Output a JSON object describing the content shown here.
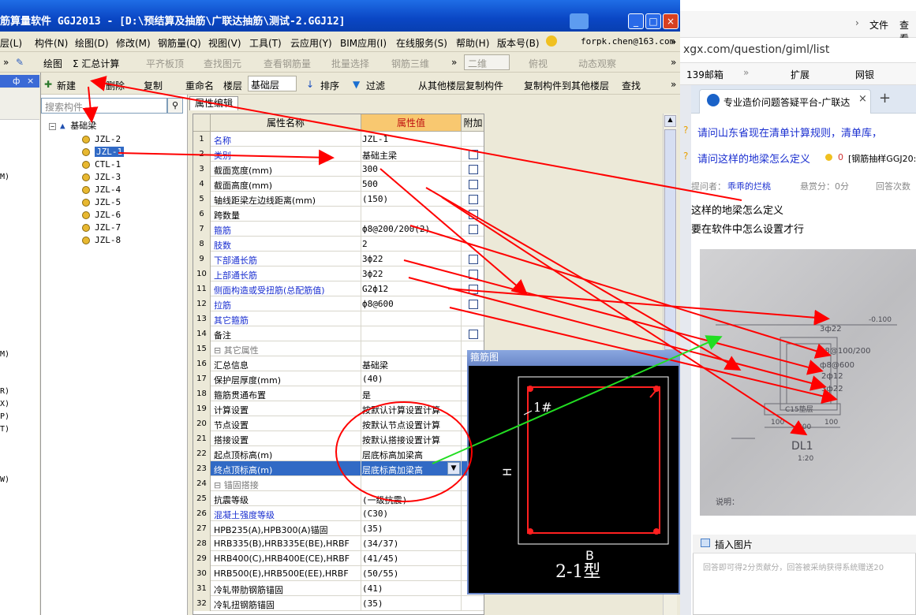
{
  "window": {
    "title": "筋算量软件 GGJ2013 - [D:\\预结算及抽筋\\广联达抽筋\\测试-2.GGJ12]",
    "minimize": "_",
    "maximize": "□",
    "close": "×"
  },
  "menu": [
    "层(L)",
    "构件(N)",
    "绘图(D)",
    "修改(M)",
    "钢筋量(Q)",
    "视图(V)",
    "工具(T)",
    "云应用(Y)",
    "BIM应用(I)",
    "在线服务(S)",
    "帮助(H)",
    "版本号(B)"
  ],
  "menu_user": "forpk.chen@163.com",
  "menu_overflow": "»",
  "toolbar1": {
    "draw": "绘图",
    "sum": "Σ 汇总计算",
    "flat": "平齐板顶",
    "find": "查找图元",
    "view_steel": "查看钢筋量",
    "batch": "批量选择",
    "steel3d": "钢筋三维",
    "dim": "二维",
    "top": "俯视",
    "orbit": "动态观察",
    "more": "»"
  },
  "dock": {
    "pin": "ф",
    "close": "×",
    "letters": [
      "M)",
      "M)",
      "R)",
      "X)",
      "P)",
      "T)",
      "W)"
    ]
  },
  "toolbar2": {
    "new": "新建",
    "delete": "删除",
    "copy": "复制",
    "rename": "重命名",
    "floor_label": "楼层",
    "floor_value": "基础层",
    "sort": "排序",
    "filter": "过滤",
    "copy_from": "从其他楼层复制构件",
    "copy_to": "复制构件到其他楼层",
    "find": "查找",
    "more": "»"
  },
  "search": {
    "placeholder": "搜索构件..."
  },
  "tree": {
    "root": "基础梁",
    "items": [
      "JZL-2",
      "JZL-1",
      "CTL-1",
      "JZL-3",
      "JZL-4",
      "JZL-5",
      "JZL-6",
      "JZL-7",
      "JZL-8"
    ],
    "selected": 1
  },
  "prop": {
    "tab": "属性编辑",
    "col_name": "属性名称",
    "col_value": "属性值",
    "col_extra": "附加"
  },
  "rows": [
    {
      "n": "1",
      "name": "名称",
      "value": "JZL-1",
      "style": "blue",
      "cb": false
    },
    {
      "n": "2",
      "name": "类别",
      "value": "基础主梁",
      "style": "blue",
      "cb": true
    },
    {
      "n": "3",
      "name": "截面宽度(mm)",
      "value": "300",
      "style": "",
      "cb": true
    },
    {
      "n": "4",
      "name": "截面高度(mm)",
      "value": "500",
      "style": "",
      "cb": true
    },
    {
      "n": "5",
      "name": "轴线距梁左边线距离(mm)",
      "value": "(150)",
      "style": "",
      "cb": true
    },
    {
      "n": "6",
      "name": "跨数量",
      "value": "",
      "style": "",
      "cb": true
    },
    {
      "n": "7",
      "name": "箍筋",
      "value": "ф8@200/200(2)",
      "style": "blue",
      "cb": true
    },
    {
      "n": "8",
      "name": "肢数",
      "value": "2",
      "style": "blue",
      "cb": false
    },
    {
      "n": "9",
      "name": "下部通长筋",
      "value": "3ф22",
      "style": "blue",
      "cb": true
    },
    {
      "n": "10",
      "name": "上部通长筋",
      "value": "3ф22",
      "style": "blue",
      "cb": true
    },
    {
      "n": "11",
      "name": "侧面构造或受扭筋(总配筋值)",
      "value": "G2ф12",
      "style": "blue",
      "cb": true
    },
    {
      "n": "12",
      "name": "拉筋",
      "value": "ф8@600",
      "style": "blue",
      "cb": true
    },
    {
      "n": "13",
      "name": "其它箍筋",
      "value": "",
      "style": "blue",
      "cb": false
    },
    {
      "n": "14",
      "name": "备注",
      "value": "",
      "style": "",
      "cb": true
    },
    {
      "n": "15",
      "name": "⊟ 其它属性",
      "value": "",
      "style": "grey",
      "cb": false
    },
    {
      "n": "16",
      "name": "汇总信息",
      "value": "基础梁",
      "style": "",
      "cb": false
    },
    {
      "n": "17",
      "name": "保护层厚度(mm)",
      "value": "(40)",
      "style": "",
      "cb": false
    },
    {
      "n": "18",
      "name": "箍筋贯通布置",
      "value": "是",
      "style": "",
      "cb": false
    },
    {
      "n": "19",
      "name": "计算设置",
      "value": "按默认计算设置计算",
      "style": "",
      "cb": false
    },
    {
      "n": "20",
      "name": "节点设置",
      "value": "按默认节点设置计算",
      "style": "",
      "cb": false
    },
    {
      "n": "21",
      "name": "搭接设置",
      "value": "按默认搭接设置计算",
      "style": "",
      "cb": false
    },
    {
      "n": "22",
      "name": "起点顶标高(m)",
      "value": "层底标高加梁高",
      "style": "",
      "cb": false
    },
    {
      "n": "23",
      "name": "终点顶标高(m)",
      "value": "层底标高加梁高",
      "style": "sel",
      "cb": false
    },
    {
      "n": "24",
      "name": "⊟ 锚固搭接",
      "value": "",
      "style": "grey",
      "cb": false
    },
    {
      "n": "25",
      "name": "抗震等级",
      "value": "(一级抗震)",
      "style": "",
      "cb": false
    },
    {
      "n": "26",
      "name": "混凝土强度等级",
      "value": "(C30)",
      "style": "blue",
      "cb": false
    },
    {
      "n": "27",
      "name": "HPB235(A),HPB300(A)锚固",
      "value": "(35)",
      "style": "",
      "cb": false
    },
    {
      "n": "28",
      "name": "HRB335(B),HRB335E(BE),HRBF",
      "value": "(34/37)",
      "style": "",
      "cb": false
    },
    {
      "n": "29",
      "name": "HRB400(C),HRB400E(CE),HRBF",
      "value": "(41/45)",
      "style": "",
      "cb": false
    },
    {
      "n": "30",
      "name": "HRB500(E),HRB500E(EE),HRBF",
      "value": "(50/55)",
      "style": "",
      "cb": false
    },
    {
      "n": "31",
      "name": "冷轧带肋钢筋锚固",
      "value": "(41)",
      "style": "",
      "cb": false
    },
    {
      "n": "32",
      "name": "冷轧扭钢筋锚固",
      "value": "(35)",
      "style": "",
      "cb": false
    }
  ],
  "stirrup": {
    "title": "箍筋图",
    "label_1": "1#",
    "label_h": "H",
    "label_b": "B",
    "type": "2-1型"
  },
  "browser": {
    "file": "文件",
    "view": "查看",
    "url": "xgx.com/question/giml/list",
    "bm_mail": "139邮箱",
    "bm_ext": "扩展",
    "bm_bank": "网银",
    "tab_title": "专业造价问题答疑平台-广联达",
    "tab_close": "×",
    "tab_new": "+",
    "q1": "请问山东省现在清单计算规则，清单库，",
    "q2": "请问这样的地梁怎么定义",
    "q2_score": "0",
    "q2_tag": "[钢筋抽样GGJ20:",
    "meta_asker": "提问者：",
    "meta_name": "乖乖的烂桃",
    "meta_reward": "悬赏分：0分",
    "meta_count": "回答次数",
    "body1": "这样的地梁怎么定义",
    "body2": "要在软件中怎么设置才行",
    "insert_image": "插入图片",
    "answer_placeholder": "回答即可得2分贡献分，回答被采纳获得系统赠送20"
  },
  "photo": {
    "t1": "3ф22",
    "t2": "ф8@100/200",
    "t3": "ф8@600",
    "t4": "2ф12",
    "t5": "3ф22",
    "t6": "C15垫层",
    "t7": "100",
    "t8": "300",
    "t9": "100",
    "t10": "DL1",
    "t11": "1:20",
    "t12": "-0.100",
    "t13": "说明："
  },
  "colors": {
    "title_blue": "#0b52d4",
    "arrow_red": "#ff0000",
    "arrow_green": "#22dd22",
    "selection": "#316ac5"
  }
}
